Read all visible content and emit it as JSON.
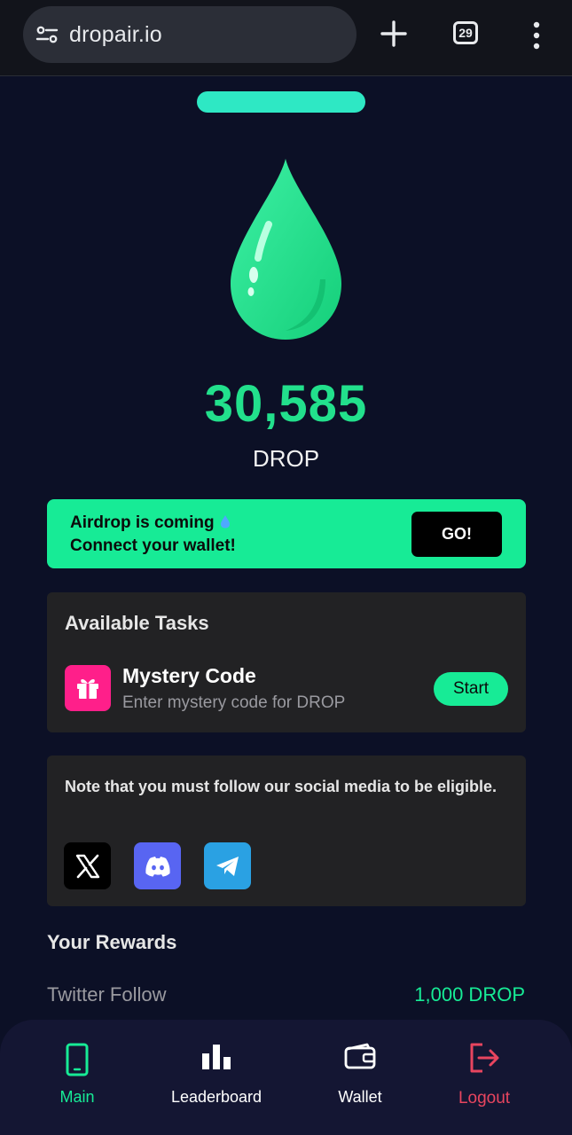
{
  "browser": {
    "url": "dropair.io",
    "tab_count": "29",
    "icons": [
      "site-settings-icon",
      "plus-icon",
      "tab-switcher-icon",
      "more-vert-icon"
    ]
  },
  "hero": {
    "balance": "30,585",
    "unit": "DROP",
    "logo_icon": "water-drop-icon"
  },
  "airdrop": {
    "line1": "Airdrop is coming",
    "line2": "Connect your wallet!",
    "button": "GO!"
  },
  "tasks": {
    "title": "Available Tasks",
    "items": [
      {
        "title": "Mystery Code",
        "description": "Enter mystery code for DROP",
        "button": "Start",
        "icon": "gift-icon"
      }
    ]
  },
  "social": {
    "note": "Note that you must follow our social media to be eligible.",
    "links": [
      {
        "name": "X",
        "icon": "x-icon"
      },
      {
        "name": "Discord",
        "icon": "discord-icon"
      },
      {
        "name": "Telegram",
        "icon": "telegram-icon"
      }
    ]
  },
  "rewards": {
    "title": "Your Rewards",
    "items": [
      {
        "label": "Twitter Follow",
        "value": "1,000 DROP"
      }
    ]
  },
  "nav": {
    "items": [
      {
        "label": "Main",
        "icon": "phone-icon",
        "active": true
      },
      {
        "label": "Leaderboard",
        "icon": "bar-chart-icon"
      },
      {
        "label": "Wallet",
        "icon": "wallet-icon"
      },
      {
        "label": "Logout",
        "icon": "logout-icon"
      }
    ]
  },
  "colors": {
    "background": "#0c1026",
    "accent": "#17eb96",
    "balance": "#22e08c",
    "logout": "#e8455f",
    "gift": "#ff1f8a",
    "discord": "#5865f2",
    "telegram": "#2aa1e3"
  }
}
